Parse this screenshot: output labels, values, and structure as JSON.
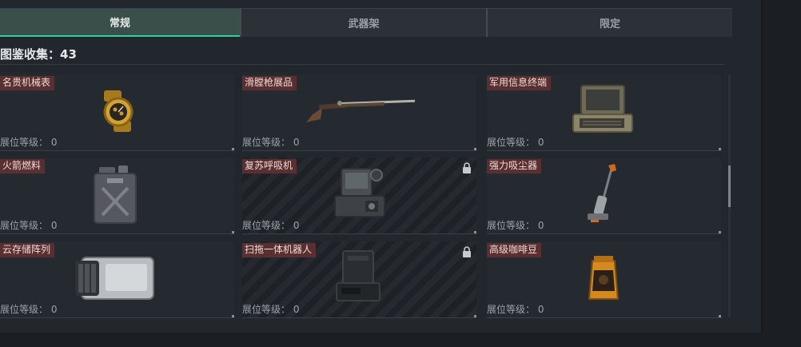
{
  "tabs": [
    {
      "label": "常规",
      "active": true
    },
    {
      "label": "武器架",
      "active": false
    },
    {
      "label": "限定",
      "active": false
    }
  ],
  "collection": {
    "label": "图鉴收集：43"
  },
  "level_label": "展位等级：",
  "items": [
    {
      "name": "名贵机械表",
      "level": "0",
      "locked": false,
      "icon": "gold-watch-icon"
    },
    {
      "name": "滑膛枪展品",
      "level": "0",
      "locked": false,
      "icon": "musket-icon"
    },
    {
      "name": "军用信息终端",
      "level": "0",
      "locked": false,
      "icon": "military-terminal-icon"
    },
    {
      "name": "火箭燃料",
      "level": "0",
      "locked": false,
      "icon": "fuel-can-icon"
    },
    {
      "name": "复苏呼吸机",
      "level": "0",
      "locked": true,
      "icon": "ventilator-icon"
    },
    {
      "name": "强力吸尘器",
      "level": "0",
      "locked": false,
      "icon": "vacuum-cleaner-icon"
    },
    {
      "name": "云存储阵列",
      "level": "0",
      "locked": false,
      "icon": "storage-array-icon"
    },
    {
      "name": "扫拖一体机器人",
      "level": "0",
      "locked": true,
      "icon": "mop-robot-icon"
    },
    {
      "name": "高级咖啡豆",
      "level": "0",
      "locked": false,
      "icon": "coffee-bag-icon"
    }
  ],
  "colors": {
    "accent": "#2ed39a",
    "tag_bg": "#5a2f31"
  }
}
